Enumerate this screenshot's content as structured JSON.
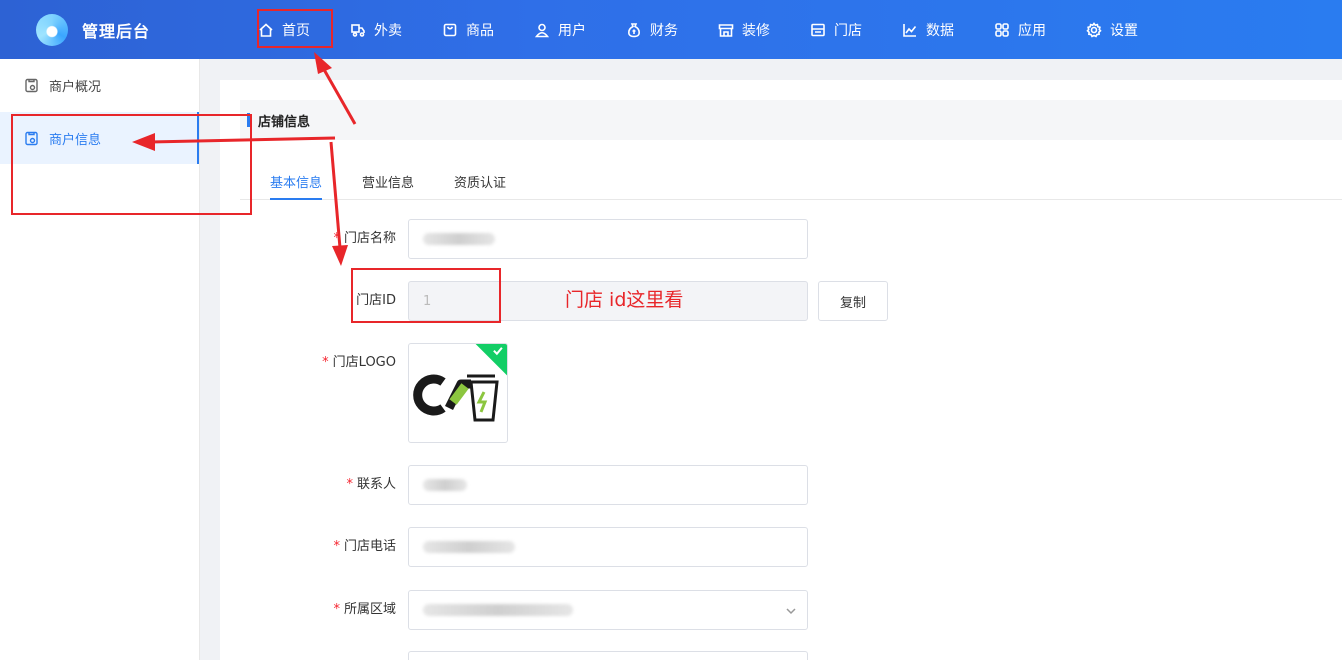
{
  "app": {
    "title": "管理后台"
  },
  "nav": {
    "items": [
      {
        "label": "首页",
        "icon": "home-icon"
      },
      {
        "label": "外卖",
        "icon": "delivery-icon"
      },
      {
        "label": "商品",
        "icon": "bag-icon"
      },
      {
        "label": "用户",
        "icon": "user-icon"
      },
      {
        "label": "财务",
        "icon": "money-bag-icon"
      },
      {
        "label": "装修",
        "icon": "storefront-icon"
      },
      {
        "label": "门店",
        "icon": "store-icon"
      },
      {
        "label": "数据",
        "icon": "line-chart-icon"
      },
      {
        "label": "应用",
        "icon": "grid-icon"
      },
      {
        "label": "设置",
        "icon": "gear-icon"
      }
    ]
  },
  "sidebar": {
    "items": [
      {
        "label": "商户概况",
        "icon": "document-icon",
        "active": false
      },
      {
        "label": "商户信息",
        "icon": "document-icon",
        "active": true
      }
    ]
  },
  "section": {
    "title": "店铺信息"
  },
  "tabs": [
    {
      "label": "基本信息",
      "active": true
    },
    {
      "label": "营业信息",
      "active": false
    },
    {
      "label": "资质认证",
      "active": false
    }
  ],
  "form": {
    "store_name": {
      "label": "门店名称",
      "required": true,
      "value": ""
    },
    "store_id": {
      "label": "门店ID",
      "required": false,
      "value": "1",
      "copy_label": "复制"
    },
    "store_logo": {
      "label": "门店LOGO",
      "required": true
    },
    "contact": {
      "label": "联系人",
      "required": true,
      "value": ""
    },
    "phone": {
      "label": "门店电话",
      "required": true,
      "value": ""
    },
    "region": {
      "label": "所属区域",
      "required": true,
      "value": ""
    }
  },
  "annotation": {
    "text": "门店  id这里看",
    "color": "#e8262a"
  },
  "colors": {
    "primary": "#2a7cf0",
    "required": "#f5222d",
    "success": "#13ce66"
  }
}
